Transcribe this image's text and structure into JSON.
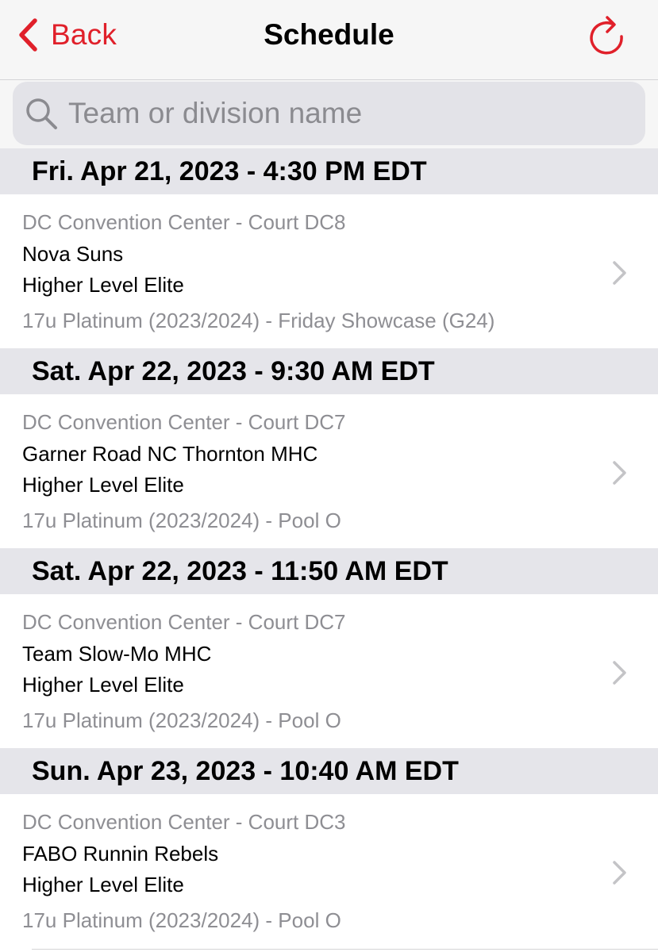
{
  "nav": {
    "back_label": "Back",
    "title": "Schedule",
    "back_icon": "chevron-left-icon",
    "refresh_icon": "refresh-icon"
  },
  "search": {
    "placeholder": "Team or division name",
    "value": "",
    "icon": "search-icon"
  },
  "colors": {
    "accent": "#e0202a",
    "section_bg": "#e5e5ea",
    "secondary_text": "#8e8e93"
  },
  "games": [
    {
      "datetime": "Fri. Apr 21, 2023 - 4:30 PM EDT",
      "venue": "DC Convention Center - Court DC8",
      "team": "Nova Suns",
      "club": "Higher Level Elite",
      "division": "17u Platinum (2023/2024) - Friday Showcase (G24)"
    },
    {
      "datetime": "Sat. Apr 22, 2023 - 9:30 AM EDT",
      "venue": "DC Convention Center - Court DC7",
      "team": "Garner Road NC Thornton MHC",
      "club": "Higher Level Elite",
      "division": "17u Platinum (2023/2024) - Pool O"
    },
    {
      "datetime": "Sat. Apr 22, 2023 - 11:50 AM EDT",
      "venue": "DC Convention Center - Court DC7",
      "team": "Team Slow-Mo MHC",
      "club": "Higher Level Elite",
      "division": "17u Platinum (2023/2024) - Pool O"
    },
    {
      "datetime": "Sun. Apr 23, 2023 - 10:40 AM EDT",
      "venue": "DC Convention Center - Court DC3",
      "team": "FABO Runnin Rebels",
      "club": "Higher Level Elite",
      "division": "17u Platinum (2023/2024) - Pool O"
    }
  ]
}
